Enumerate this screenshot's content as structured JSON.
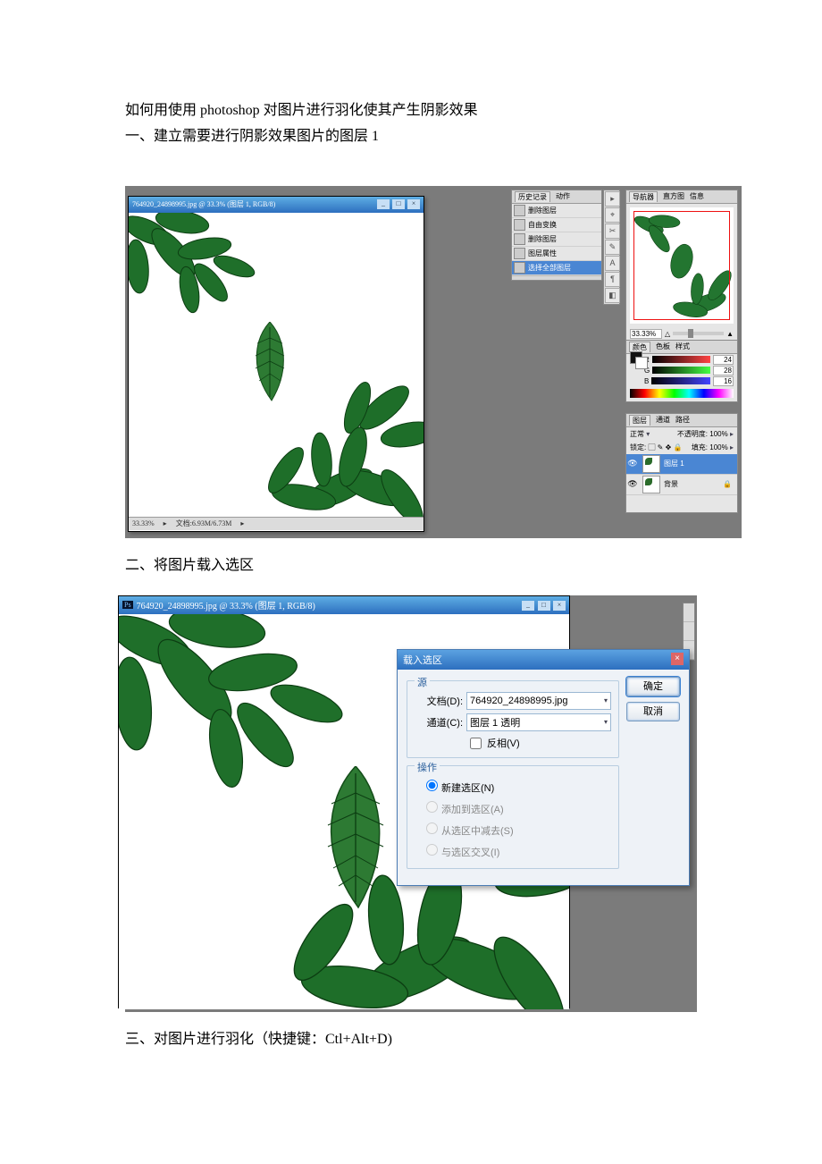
{
  "heading": {
    "title": "如何用使用 photoshop 对图片进行羽化使其产生阴影效果",
    "step1": "一、建立需要进行阴影效果图片的图层 1",
    "step2": "二、将图片载入选区",
    "step3": "三、对图片进行羽化（快捷键：Ctl+Alt+D)"
  },
  "fig1": {
    "doc_title": "764920_24898995.jpg @ 33.3% (图层 1, RGB/8)",
    "status_zoom": "33.33%",
    "status_docinfo": "文档:6.93M/6.73M",
    "history": {
      "tab1": "历史记录",
      "tab2": "动作",
      "rows": [
        "删除图层",
        "自由变换",
        "删除图层",
        "图层属性",
        "选择全部图层"
      ]
    },
    "navigator": {
      "tab1": "导航器",
      "tab2": "直方图",
      "tab3": "信息",
      "zoom": "33.33%"
    },
    "color_panel": {
      "tab1": "颜色",
      "tab2": "色板",
      "tab3": "样式",
      "r": "24",
      "g": "28",
      "b": "16"
    },
    "layers_panel": {
      "tab1": "图层",
      "tab2": "通道",
      "tab3": "路径",
      "mode": "正常",
      "opacity_label": "不透明度:",
      "opacity_val": "100%",
      "lock_label": "锁定:",
      "fill_label": "填充:",
      "fill_val": "100%",
      "layer1": "图层 1",
      "bg": "背景"
    }
  },
  "fig2": {
    "doc_title": "764920_24898995.jpg @ 33.3% (图层 1, RGB/8)",
    "dialog": {
      "title": "载入选区",
      "group_source": "源",
      "doc_label": "文档(D):",
      "doc_value": "764920_24898995.jpg",
      "channel_label": "通道(C):",
      "channel_value": "图层 1 透明",
      "invert": "反相(V)",
      "group_op": "操作",
      "op_new": "新建选区(N)",
      "op_add": "添加到选区(A)",
      "op_sub": "从选区中减去(S)",
      "op_int": "与选区交叉(I)",
      "ok": "确定",
      "cancel": "取消"
    }
  }
}
